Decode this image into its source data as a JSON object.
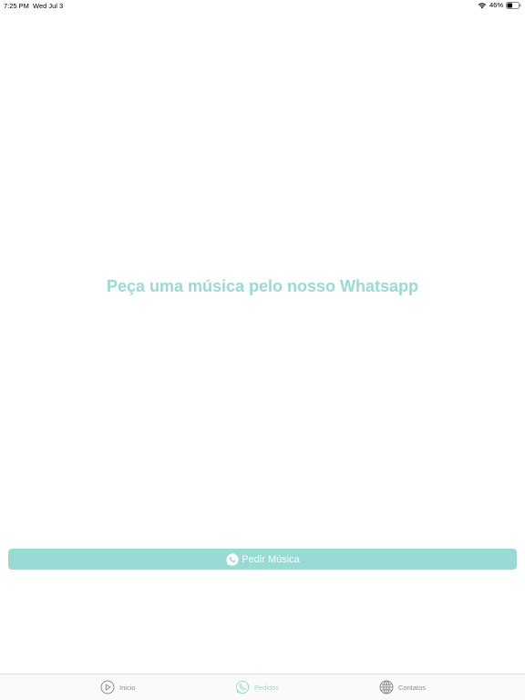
{
  "status_bar": {
    "time": "7:25 PM",
    "date": "Wed Jul 3",
    "battery": "46%",
    "battery_level": 0.46,
    "icons": [
      "wifi-icon",
      "battery-icon"
    ]
  },
  "main": {
    "headline": "Peça uma música pelo nosso Whatsapp",
    "request_button_label": "Pedir Música",
    "request_button_icon": "whatsapp-icon"
  },
  "tab_bar": {
    "tabs": [
      {
        "label": "Inicio",
        "icon": "play-circle-icon",
        "active": false
      },
      {
        "label": "Pedidos",
        "icon": "whatsapp-icon",
        "active": true
      },
      {
        "label": "Contatos",
        "icon": "globe-icon",
        "active": false
      }
    ]
  },
  "colors": {
    "accent": "#9adad4",
    "inactive": "#8e8e8e",
    "background": "#ffffff"
  }
}
